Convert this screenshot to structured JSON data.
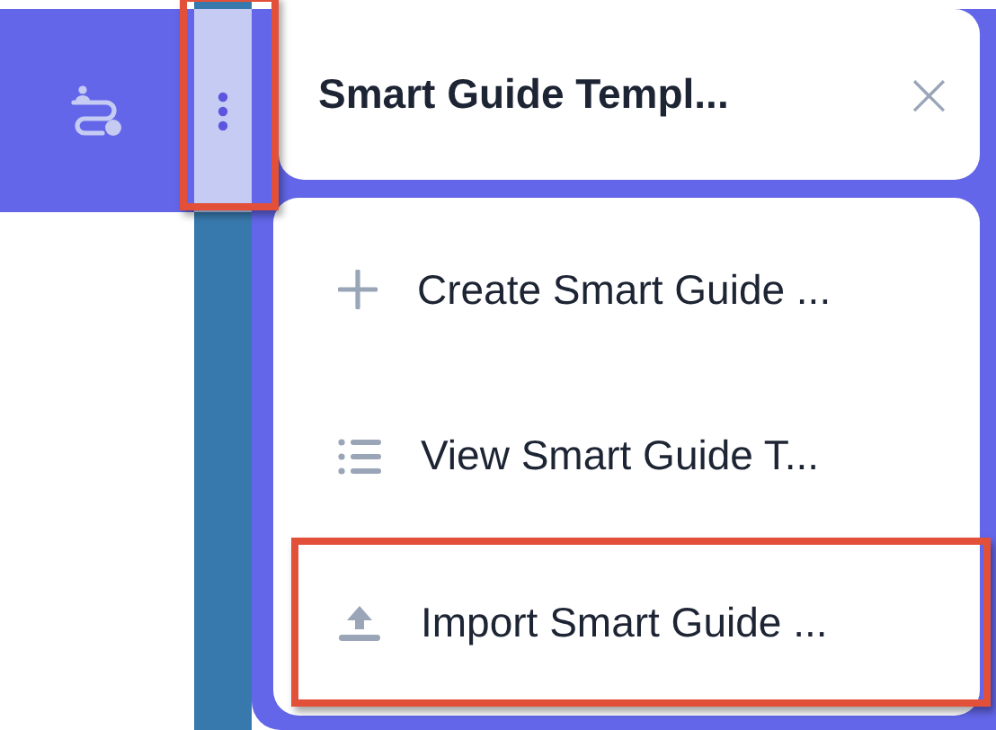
{
  "menu_button": {
    "highlighted": true
  },
  "panel": {
    "title": "Smart Guide Templ...",
    "close": "×"
  },
  "items": [
    {
      "kind": "create",
      "label": "Create Smart Guide ...",
      "highlighted": false
    },
    {
      "kind": "view",
      "label": "View Smart Guide T...",
      "highlighted": false
    },
    {
      "kind": "import",
      "label": "Import Smart Guide ...",
      "highlighted": true
    }
  ]
}
